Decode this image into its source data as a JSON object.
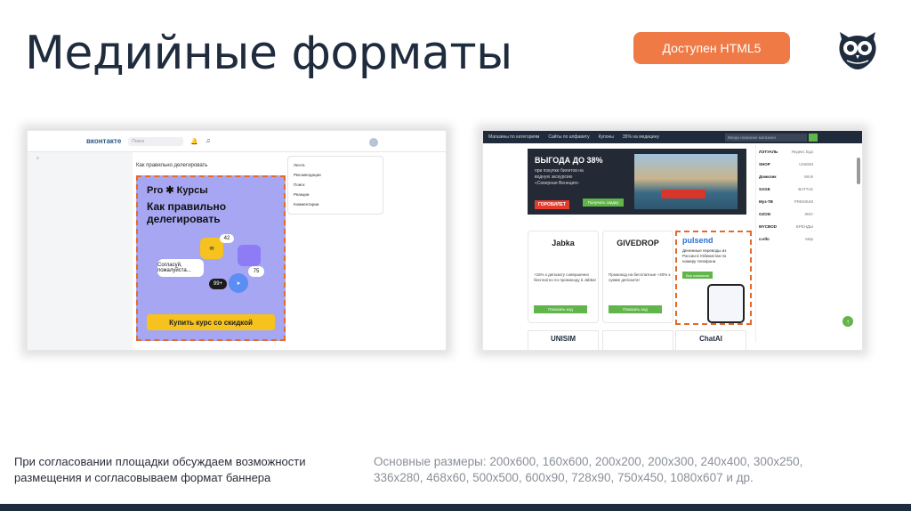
{
  "slide": {
    "title": "Медийные форматы",
    "badge": "Доступен HTML5",
    "note_left": "При согласовании площадки обсуждаем возможности размещения и согласовываем формат баннера",
    "note_right": "Основные размеры: 200x600, 160x600, 200x200, 200x300, 240x400, 300x250, 336x280, 468x60, 500x500, 600x90, 728x90, 750x450, 1080x607 и др.",
    "colors": {
      "accent": "#ef7a45",
      "navy": "#1f2c3e",
      "muted": "#8a8f98"
    }
  },
  "vk_screenshot": {
    "logo": "вконтакте",
    "search_placeholder": "Поиск",
    "post_header": "Как правильно делегировать",
    "brand": "Pro ✱ Курсы",
    "headline": "Как правильно делегировать",
    "bubble_text": "Согласуй, пожалуйста...",
    "badge_42": "42",
    "badge_75": "75",
    "badge_99": "99+",
    "cta": "Купить курс со скидкой",
    "menu_items": [
      "Лента",
      "Рекомендации",
      "Поиск",
      "Реакции",
      "Комментарии"
    ]
  },
  "promo_screenshot": {
    "nav": [
      "Магазины по категориям",
      "Сайты по алфавиту",
      "Купоны",
      "35% на медицину"
    ],
    "search_placeholder": "Введи название магазина",
    "banner_title": "ВЫГОДА ДО 38%",
    "banner_sub": "при покупке билетов на водную экскурсию «Северная Венеция»",
    "banner_logo": "ГОРОБИЛЕТ",
    "banner_button": "Получить скидку",
    "cards": [
      {
        "logo": "Jabka",
        "text": "+15% к депозиту совершенно бесплатно по промокоду в Jabka!",
        "button": "Показать код"
      },
      {
        "logo": "GIVEDROP",
        "text": "Промокод на бесплатные +40% к сумме депозита!",
        "button": "Показать код"
      }
    ],
    "pulse": {
      "logo": "pulsend",
      "text": "Денежные переводы из России в Узбекистан по номеру телефона",
      "button": "Все компании"
    },
    "sidebar": [
      {
        "brand": "ЛЭТУАЛЬ",
        "label": "Яндекс Еда"
      },
      {
        "brand": "SHOP",
        "label": "UNISIM"
      },
      {
        "brand": "Домклик",
        "label": "Wink"
      },
      {
        "brand": "SAGE",
        "label": "BATTLE"
      },
      {
        "brand": "Муз-ТВ",
        "label": "PREMIUM"
      },
      {
        "brand": "OZON",
        "label": "ЖКУ"
      },
      {
        "brand": "MYCBOD",
        "label": "БРЕНДЫ"
      },
      {
        "brand": "о.ello",
        "label": "Мир"
      }
    ],
    "bottom_cards": [
      "UNISIM",
      "",
      "ChatAI"
    ]
  }
}
